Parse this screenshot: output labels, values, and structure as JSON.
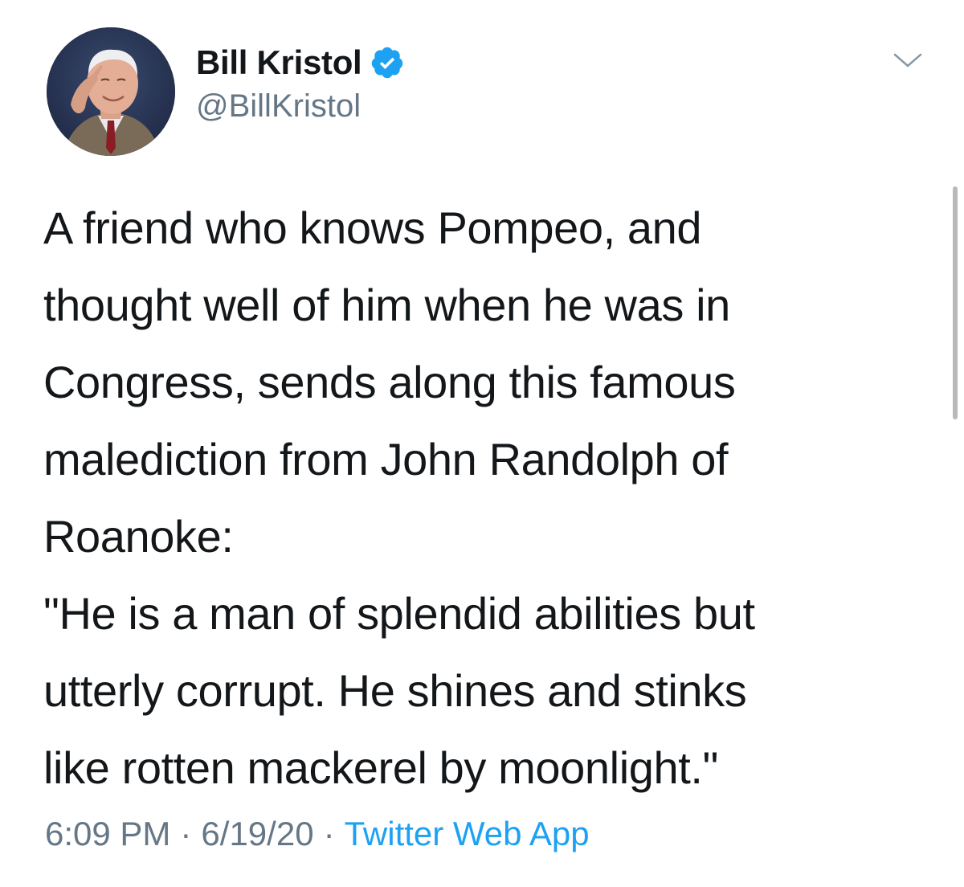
{
  "author": {
    "display_name": "Bill Kristol",
    "handle": "@BillKristol",
    "verified": true,
    "avatar_icon": "profile-photo"
  },
  "tweet": {
    "lines": [
      "A friend who knows Pompeo, and",
      "thought well of him when he was in",
      "Congress, sends along this famous",
      "malediction from John Randolph of",
      "Roanoke:",
      "\"He is a man of splendid abilities but",
      "utterly corrupt. He shines and stinks",
      "like rotten mackerel by moonlight.\""
    ]
  },
  "meta": {
    "time": "6:09 PM",
    "date": "6/19/20",
    "separator": "·",
    "source": "Twitter Web App"
  },
  "icons": {
    "verified": "verified-badge-icon",
    "more": "chevron-down-icon"
  },
  "colors": {
    "text": "#14171a",
    "secondary": "#657786",
    "link": "#1da1f2",
    "verified": "#1da1f2"
  }
}
